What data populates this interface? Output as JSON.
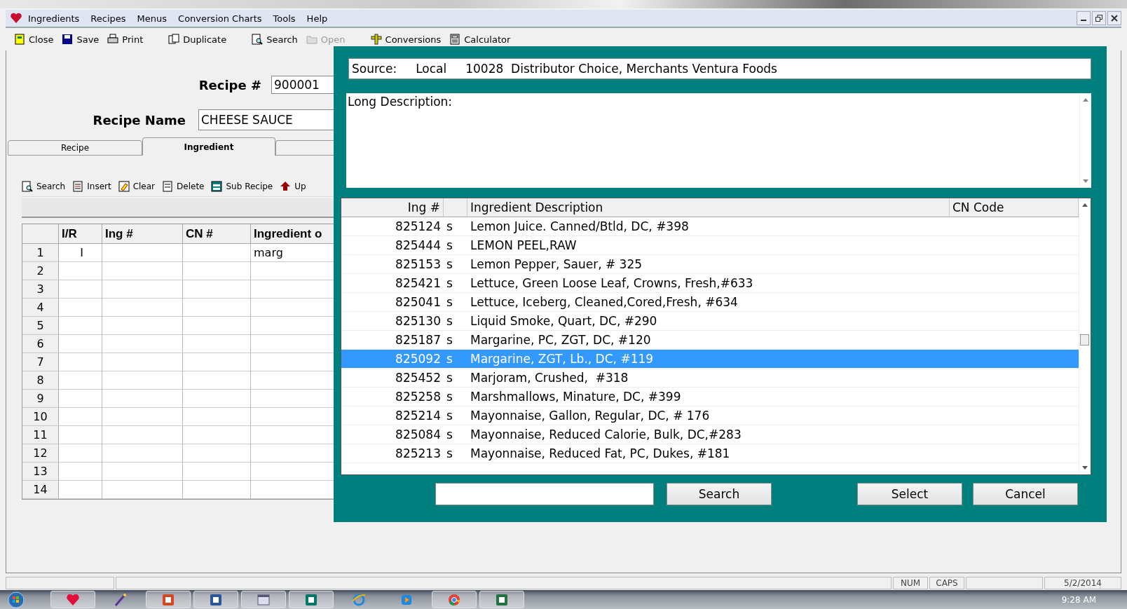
{
  "menu": [
    "Ingredients",
    "Recipes",
    "Menus",
    "Conversion Charts",
    "Tools",
    "Help"
  ],
  "toolbar": [
    {
      "kind": "close",
      "label": "Close",
      "disabled": false
    },
    {
      "kind": "save",
      "label": "Save",
      "disabled": false
    },
    {
      "kind": "print",
      "label": "Print",
      "disabled": false
    },
    {
      "kind": "duplicate",
      "label": "Duplicate",
      "disabled": false
    },
    {
      "kind": "search",
      "label": "Search",
      "disabled": false
    },
    {
      "kind": "open",
      "label": "Open",
      "disabled": true
    },
    {
      "kind": "conversions",
      "label": "Conversions",
      "disabled": false
    },
    {
      "kind": "calculator",
      "label": "Calculator",
      "disabled": false
    }
  ],
  "recipe": {
    "number_label": "Recipe #",
    "number": "900001",
    "name_label": "Recipe Name",
    "name": "CHEESE SAUCE"
  },
  "tabs": [
    {
      "label": "Recipe",
      "selected": false
    },
    {
      "label": "Ingredient",
      "selected": true
    }
  ],
  "grid_toolbar": [
    {
      "kind": "search",
      "label": "Search"
    },
    {
      "kind": "insert",
      "label": "Insert"
    },
    {
      "kind": "clear",
      "label": "Clear"
    },
    {
      "kind": "delete",
      "label": "Delete"
    },
    {
      "kind": "subrecipe",
      "label": "Sub Recipe"
    },
    {
      "kind": "up",
      "label": "Up"
    }
  ],
  "recipe_grid": {
    "columns": [
      "I/R",
      "Ing #",
      "CN #",
      "Ingredient o"
    ],
    "rows": [
      {
        "number": "1",
        "ir": "I",
        "ingredient": "marg"
      },
      {
        "number": "2"
      },
      {
        "number": "3"
      },
      {
        "number": "4"
      },
      {
        "number": "5"
      },
      {
        "number": "6"
      },
      {
        "number": "7"
      },
      {
        "number": "8"
      },
      {
        "number": "9"
      },
      {
        "number": "10"
      },
      {
        "number": "11"
      },
      {
        "number": "12"
      },
      {
        "number": "13"
      },
      {
        "number": "14"
      }
    ]
  },
  "dialog": {
    "source": "Source:     Local     10028  Distributor Choice, Merchants Ventura Foods",
    "long_description_label": "Long Description:",
    "columns": {
      "ing": "Ing #",
      "description": "Ingredient Description",
      "cn_code": "CN Code"
    },
    "rows": [
      {
        "ing": "825124",
        "flag": "s",
        "description": "Lemon Juice. Canned/Btld, DC, #398",
        "selected": false
      },
      {
        "ing": "825444",
        "flag": "s",
        "description": "LEMON PEEL,RAW",
        "selected": false
      },
      {
        "ing": "825153",
        "flag": "s",
        "description": "Lemon Pepper, Sauer, # 325",
        "selected": false
      },
      {
        "ing": "825421",
        "flag": "s",
        "description": "Lettuce, Green Loose Leaf, Crowns, Fresh,#633",
        "selected": false
      },
      {
        "ing": "825041",
        "flag": "s",
        "description": "Lettuce, Iceberg, Cleaned,Cored,Fresh, #634",
        "selected": false
      },
      {
        "ing": "825130",
        "flag": "s",
        "description": "Liquid Smoke, Quart, DC, #290",
        "selected": false
      },
      {
        "ing": "825187",
        "flag": "s",
        "description": "Margarine, PC, ZGT, DC, #120",
        "selected": false
      },
      {
        "ing": "825092",
        "flag": "s",
        "description": "Margarine, ZGT, Lb., DC, #119",
        "selected": true
      },
      {
        "ing": "825452",
        "flag": "s",
        "description": "Marjoram, Crushed,  #318",
        "selected": false
      },
      {
        "ing": "825258",
        "flag": "s",
        "description": "Marshmallows, Minature, DC, #399",
        "selected": false
      },
      {
        "ing": "825214",
        "flag": "s",
        "description": "Mayonnaise, Gallon, Regular, DC, # 176",
        "selected": false
      },
      {
        "ing": "825084",
        "flag": "s",
        "description": "Mayonnaise, Reduced Calorie, Bulk, DC,#283",
        "selected": false
      },
      {
        "ing": "825213",
        "flag": "s",
        "description": "Mayonnaise, Reduced Fat, PC, Dukes, #181",
        "selected": false
      }
    ],
    "buttons": {
      "search": "Search",
      "select": "Select",
      "cancel": "Cancel"
    }
  },
  "status_bar": {
    "num": "NUM",
    "caps": "CAPS",
    "date": "5/2/2014"
  },
  "taskbar": {
    "apps": [
      {
        "kind": "heart",
        "open": true
      },
      {
        "kind": "wand",
        "open": false
      },
      {
        "kind": "slides",
        "open": true
      },
      {
        "kind": "doc",
        "open": true
      },
      {
        "kind": "window",
        "open": true
      },
      {
        "kind": "publisher",
        "open": true
      },
      {
        "kind": "browser",
        "open": false
      },
      {
        "kind": "media",
        "open": false
      },
      {
        "kind": "chrome",
        "open": true
      },
      {
        "kind": "sheet",
        "open": true
      }
    ],
    "clock": "9:28 AM"
  }
}
